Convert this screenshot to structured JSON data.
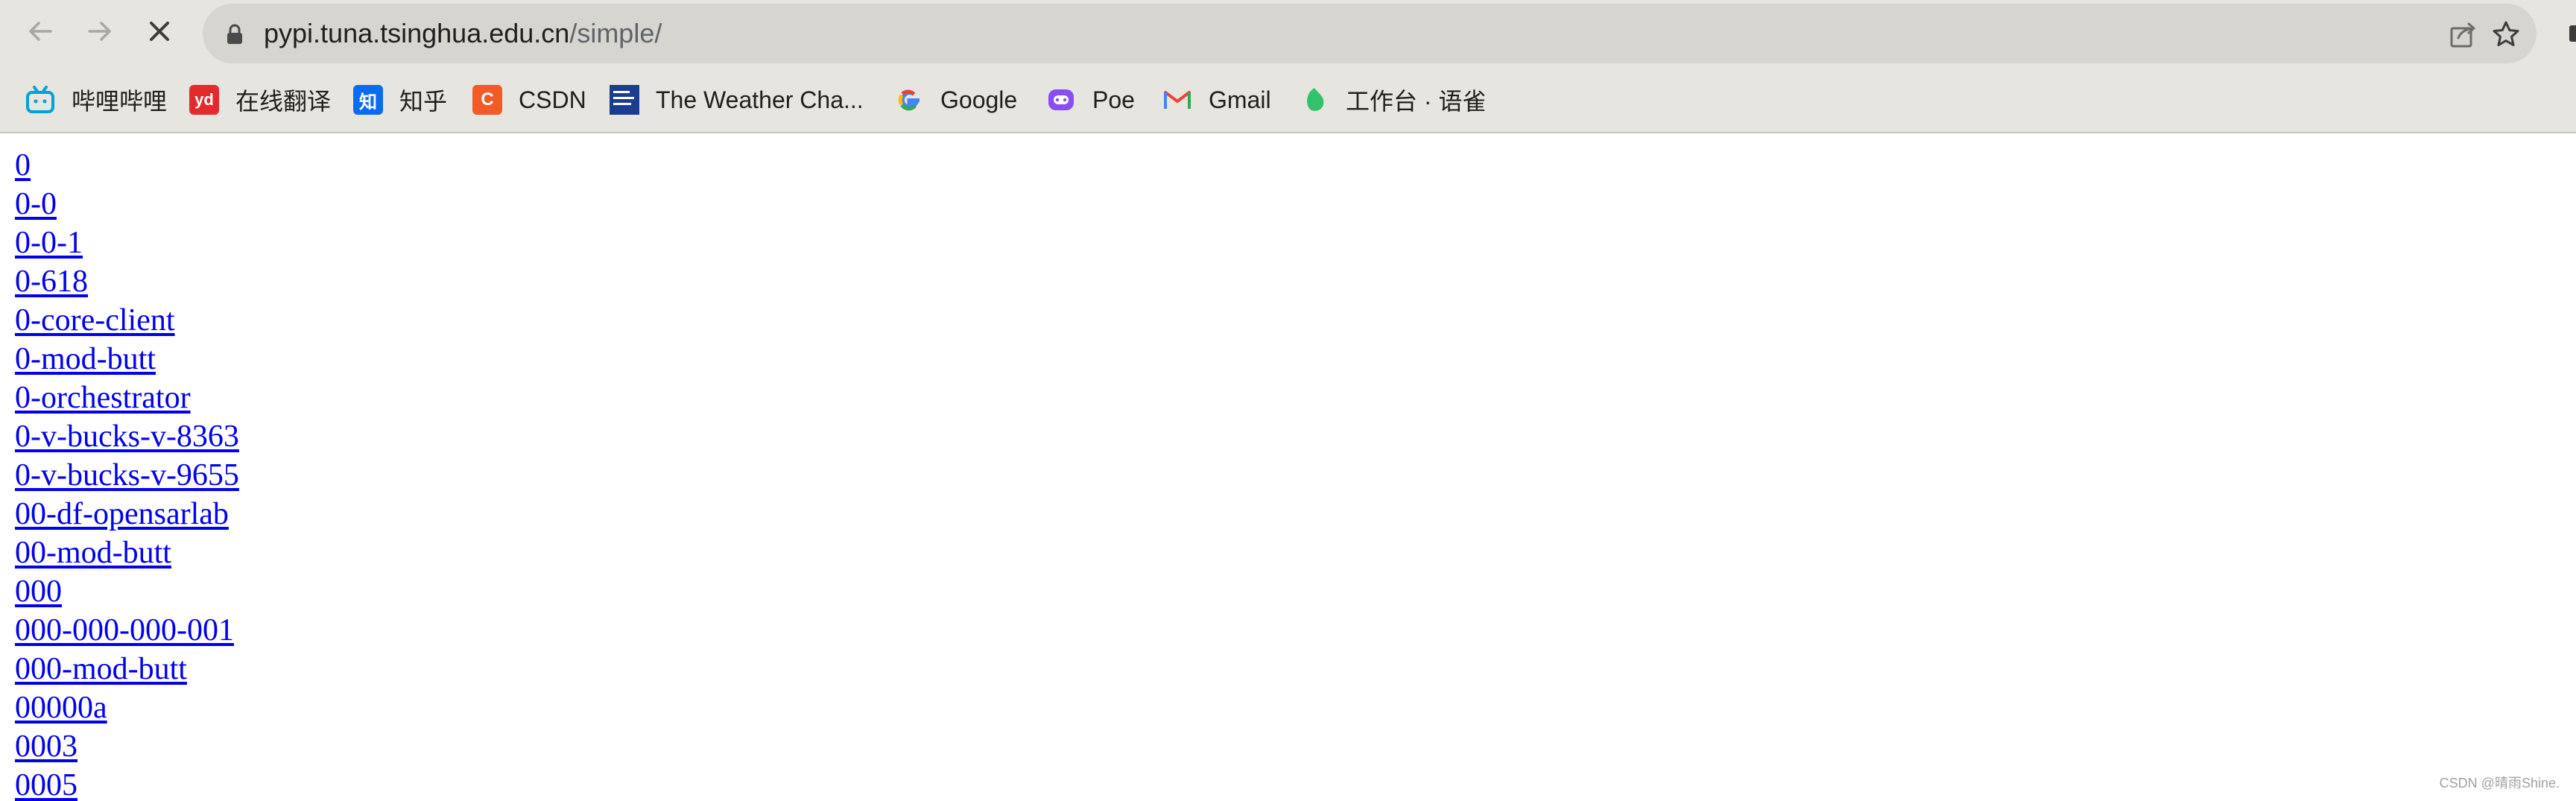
{
  "browser": {
    "url_host": "pypi.tuna.tsinghua.edu.cn",
    "url_path": "/simple/",
    "back_icon": "back-arrow-icon",
    "forward_icon": "forward-arrow-icon",
    "stop_icon": "stop-loading-x-icon",
    "lock_icon": "lock-icon",
    "share_icon": "share-icon",
    "star_icon": "bookmark-star-icon"
  },
  "bookmarks": [
    {
      "label": "哔哩哔哩",
      "icon": "bilibili-icon",
      "glyph": "",
      "color": "#00a1d6"
    },
    {
      "label": "在线翻译",
      "icon": "youdao-icon",
      "glyph": "yd",
      "color": "#e32b2b"
    },
    {
      "label": "知乎",
      "icon": "zhihu-icon",
      "glyph": "知",
      "color": "#0a6cf0"
    },
    {
      "label": "CSDN",
      "icon": "csdn-icon",
      "glyph": "C",
      "color": "#f25a29"
    },
    {
      "label": "The Weather Cha...",
      "icon": "weather-channel-icon",
      "glyph": "",
      "color": "#1b3d91"
    },
    {
      "label": "Google",
      "icon": "google-icon",
      "glyph": "G",
      "color": "#4285f4"
    },
    {
      "label": "Poe",
      "icon": "poe-icon",
      "glyph": "",
      "color": "#8a4df2"
    },
    {
      "label": "Gmail",
      "icon": "gmail-icon",
      "glyph": "M",
      "color": "#ea4335"
    },
    {
      "label": "工作台 · 语雀",
      "icon": "yuque-icon",
      "glyph": "",
      "color": "#31c26b"
    }
  ],
  "packages": [
    "0",
    "0-0",
    "0-0-1",
    "0-618",
    "0-core-client",
    "0-mod-butt",
    "0-orchestrator",
    "0-v-bucks-v-8363",
    "0-v-bucks-v-9655",
    "00-df-opensarlab",
    "00-mod-butt",
    "000",
    "000-000-000-001",
    "000-mod-butt",
    "00000a",
    "0003",
    "0005"
  ],
  "watermark": "CSDN @晴雨Shine."
}
